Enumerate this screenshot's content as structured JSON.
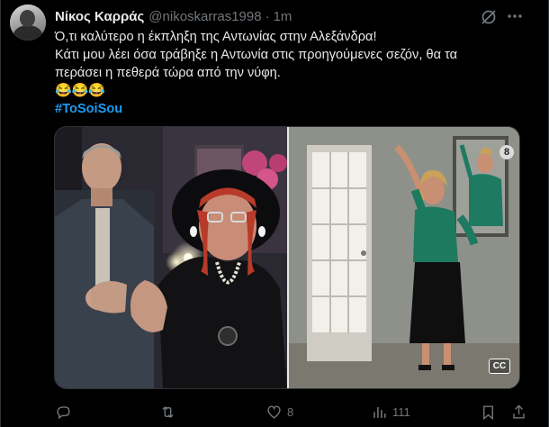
{
  "author": {
    "name": "Νίκος Καρράς",
    "handle": "@nikoskarras1998",
    "separator": "·",
    "time": "1m"
  },
  "tweet": {
    "line1": "Ό,τι καλύτερο η έκπληξη της Αντωνίας στην Αλεξάνδρα!",
    "line2": "Κάτι μου λέει όσα τράβηξε η Αντωνία στις προηγούμενες σεζόν, θα τα",
    "line3": "περάσει η πεθερά τώρα από την νύφη.",
    "emojis": "😂😂😂",
    "hashtag": "#ToSoiSou"
  },
  "media": {
    "count_badge": "8",
    "cc_label": "CC"
  },
  "actions": {
    "reply_count": "",
    "retweet_count": "",
    "like_count": "8",
    "views_count": "111"
  },
  "colors": {
    "background": "#000000",
    "text": "#e7e9ea",
    "muted": "#71767b",
    "accent": "#1d9bf0"
  }
}
